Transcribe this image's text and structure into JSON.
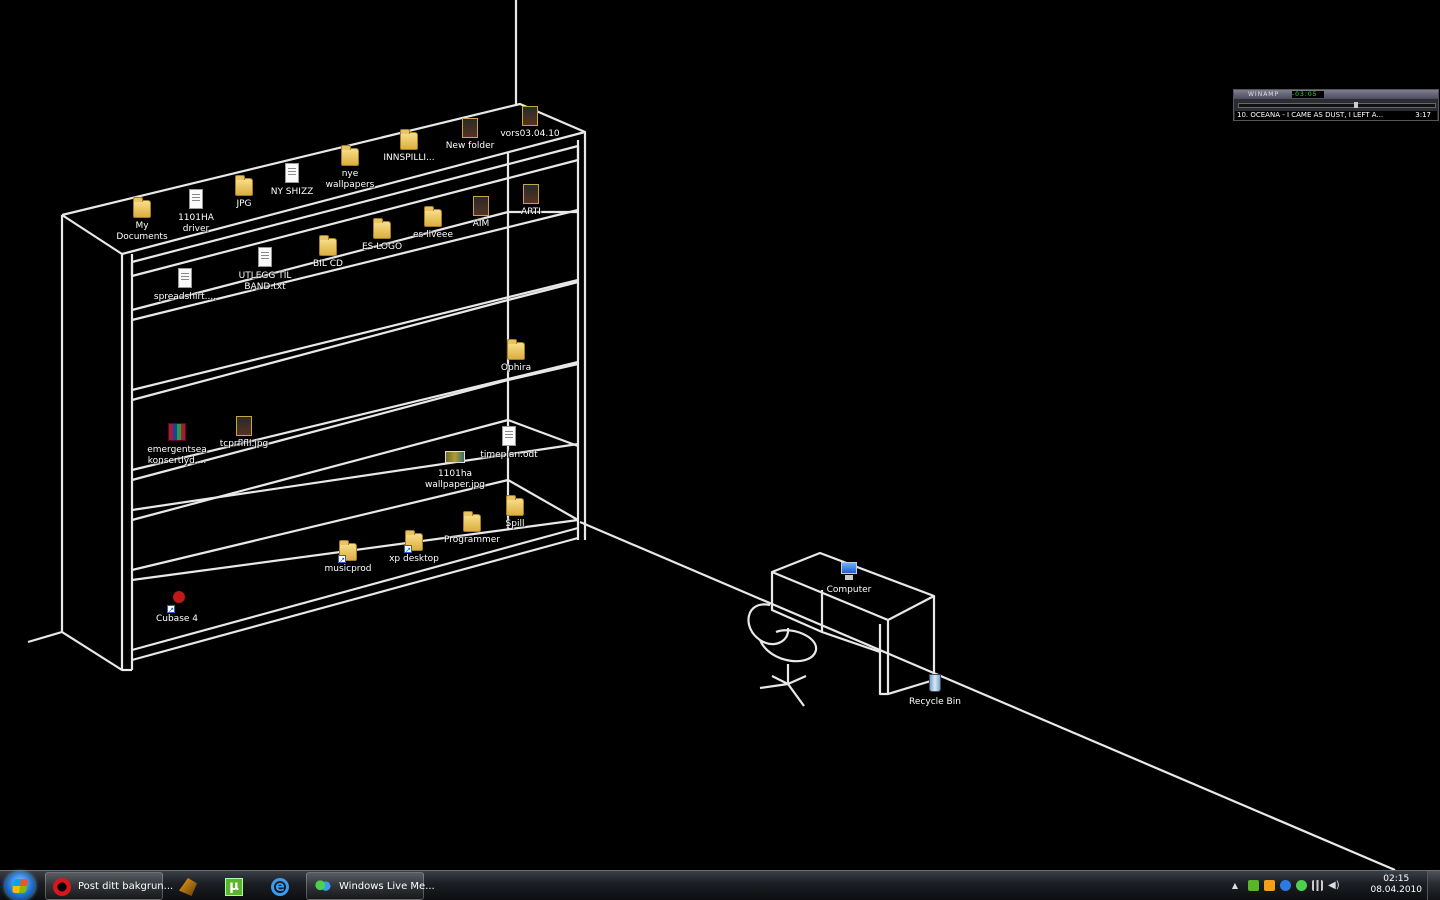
{
  "desktop": {
    "icons": [
      {
        "id": "my-documents",
        "label": "My\nDocuments",
        "type": "folder"
      },
      {
        "id": "1101ha-driver",
        "label": "1101HA\ndriver",
        "type": "doc"
      },
      {
        "id": "jpg",
        "label": "JPG",
        "type": "folder"
      },
      {
        "id": "ny-shizz",
        "label": "NY SHIZZ",
        "type": "doc"
      },
      {
        "id": "nye-wallpapers",
        "label": "nye\nwallpapers",
        "type": "folder"
      },
      {
        "id": "innspilli",
        "label": "INNSPILLI...",
        "type": "folder"
      },
      {
        "id": "new-folder",
        "label": "New folder",
        "type": "photo"
      },
      {
        "id": "vors",
        "label": "vors03.04.10",
        "type": "photo"
      },
      {
        "id": "arti",
        "label": "ARTI",
        "type": "photo"
      },
      {
        "id": "aim",
        "label": "AIM",
        "type": "photo"
      },
      {
        "id": "es-liveee",
        "label": "es liveee",
        "type": "folder"
      },
      {
        "id": "es-logo",
        "label": "ES LOGO",
        "type": "folder"
      },
      {
        "id": "bil-cd",
        "label": "BIL CD",
        "type": "folder"
      },
      {
        "id": "utlegg",
        "label": "UTLEGG TIL\nBAND.txt",
        "type": "doc"
      },
      {
        "id": "spreadshirt",
        "label": "spreadshirt....",
        "type": "doc"
      },
      {
        "id": "ophira",
        "label": "Ophira",
        "type": "folder"
      },
      {
        "id": "emergentsea",
        "label": "emergentsea\nkonsertlyd....",
        "type": "rar"
      },
      {
        "id": "tcprflfll",
        "label": "tcprflfll.jpg",
        "type": "photo"
      },
      {
        "id": "timeplan",
        "label": "timeplan.odt",
        "type": "doc"
      },
      {
        "id": "1101ha-wallpaper",
        "label": "1101ha\nwallpaper.jpg",
        "type": "thumb"
      },
      {
        "id": "spill",
        "label": "Spill",
        "type": "folder"
      },
      {
        "id": "programmer",
        "label": "Programmer",
        "type": "folder"
      },
      {
        "id": "xp-desktop",
        "label": "xp desktop",
        "type": "shortcut-folder"
      },
      {
        "id": "musicprod",
        "label": "musicprod",
        "type": "shortcut-folder"
      },
      {
        "id": "cubase",
        "label": "Cubase 4",
        "type": "cubase"
      },
      {
        "id": "computer",
        "label": "Computer",
        "type": "pc"
      },
      {
        "id": "recycle-bin",
        "label": "Recycle Bin",
        "type": "bin"
      }
    ]
  },
  "winamp": {
    "title": "WINAMP",
    "time": "-03:05",
    "track": "10. OCEANA - I CAME AS DUST, I LEFT A...",
    "duration": "3:17"
  },
  "taskbar": {
    "items": [
      {
        "label": "Post ditt bakgrun...",
        "icon": "opera-icon"
      },
      {
        "label": "",
        "icon": "winamp-icon"
      },
      {
        "label": "",
        "icon": "utorrent-icon"
      },
      {
        "label": "",
        "icon": "internet-explorer-icon"
      },
      {
        "label": "Windows Live Me...",
        "icon": "windows-live-messenger-icon"
      }
    ],
    "clock": {
      "time": "02:15",
      "date": "08.04.2010"
    }
  }
}
